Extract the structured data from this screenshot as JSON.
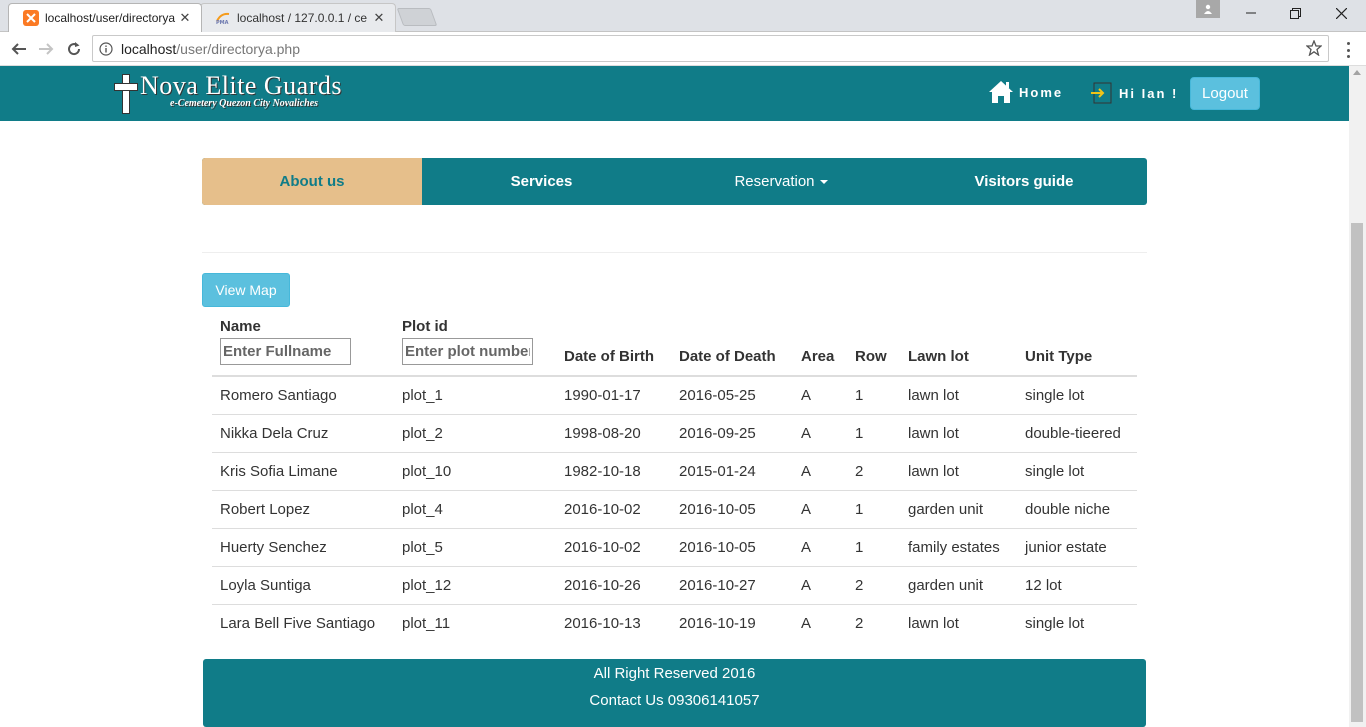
{
  "browser": {
    "tabs": [
      {
        "title": "localhost/user/directorya",
        "active": true,
        "favicon": "xampp-icon"
      },
      {
        "title": "localhost / 127.0.0.1 / ce",
        "active": false,
        "favicon": "phpmyadmin-icon"
      }
    ],
    "url_host": "localhost",
    "url_path": "/user/directorya.php"
  },
  "header": {
    "brand_title": "Nova Elite Guards",
    "brand_subtitle": "e-Cemetery Quezon City Novaliches",
    "home_label": "Home",
    "greeting": "Hi Ian !",
    "logout_label": "Logout",
    "colors": {
      "bar": "#107c88",
      "button": "#5bc0de"
    }
  },
  "nav": {
    "items": [
      {
        "label": "About us",
        "active": true
      },
      {
        "label": "Services"
      },
      {
        "label": "Reservation",
        "dropdown": true
      },
      {
        "label": "Visitors guide"
      }
    ],
    "active_color": "#e6bf8b"
  },
  "view_map_label": "View Map",
  "table": {
    "columns": [
      "Name",
      "Plot id",
      "Date of Birth",
      "Date of Death",
      "Area",
      "Row",
      "Lawn lot",
      "Unit Type"
    ],
    "filters": {
      "name_placeholder": "Enter Fullname",
      "plot_placeholder": "Enter plot number"
    },
    "rows": [
      [
        "Romero Santiago",
        "plot_1",
        "1990-01-17",
        "2016-05-25",
        "A",
        "1",
        "lawn lot",
        "single lot"
      ],
      [
        "Nikka Dela Cruz",
        "plot_2",
        "1998-08-20",
        "2016-09-25",
        "A",
        "1",
        "lawn lot",
        "double-tieered"
      ],
      [
        "Kris Sofia Limane",
        "plot_10",
        "1982-10-18",
        "2015-01-24",
        "A",
        "2",
        "lawn lot",
        "single lot"
      ],
      [
        "Robert Lopez",
        "plot_4",
        "2016-10-02",
        "2016-10-05",
        "A",
        "1",
        "garden unit",
        "double niche"
      ],
      [
        "Huerty Senchez",
        "plot_5",
        "2016-10-02",
        "2016-10-05",
        "A",
        "1",
        "family estates",
        "junior estate"
      ],
      [
        "Loyla Suntiga",
        "plot_12",
        "2016-10-26",
        "2016-10-27",
        "A",
        "2",
        "garden unit",
        "12 lot"
      ],
      [
        "Lara Bell Five Santiago",
        "plot_11",
        "2016-10-13",
        "2016-10-19",
        "A",
        "2",
        "lawn lot",
        "single lot"
      ]
    ]
  },
  "footer": {
    "rights": "All Right Reserved 2016",
    "contact": "Contact Us 09306141057"
  }
}
